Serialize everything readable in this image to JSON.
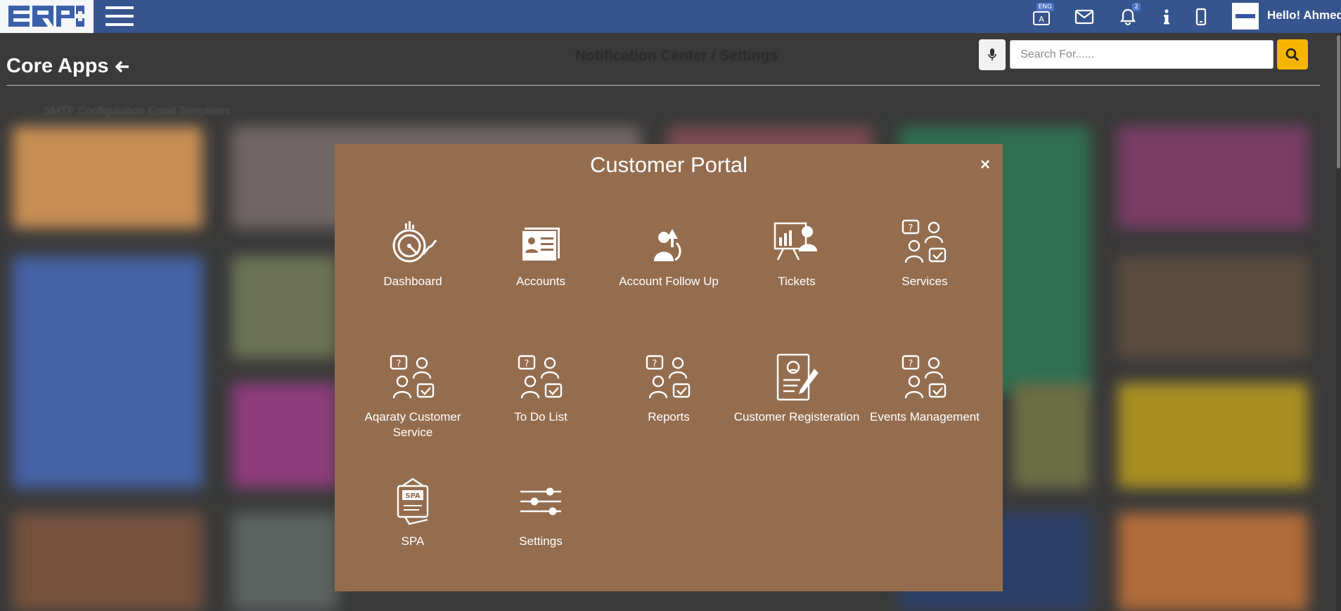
{
  "brand": {
    "logo_text": "ERP"
  },
  "topbar": {
    "lang_badge": "ENG",
    "notif_count": "2",
    "greeting": "Hello! Ahmed"
  },
  "page": {
    "title": "Core Apps",
    "heading": "Notification Center / Settings",
    "bg_text": "SMTP Configuration    Email Templates"
  },
  "search": {
    "placeholder": "Search For......"
  },
  "modal": {
    "title": "Customer Portal",
    "close": "×",
    "apps": [
      {
        "label": "Dashboard",
        "icon": "dashboard-icon"
      },
      {
        "label": "Accounts",
        "icon": "accounts-icon"
      },
      {
        "label": "Account Follow Up",
        "icon": "follow-up-icon"
      },
      {
        "label": "Tickets",
        "icon": "tickets-icon"
      },
      {
        "label": "Services",
        "icon": "services-icon"
      },
      {
        "label": "Aqaraty Customer Service",
        "icon": "customer-service-icon"
      },
      {
        "label": "To Do List",
        "icon": "todo-icon"
      },
      {
        "label": "Reports",
        "icon": "reports-icon"
      },
      {
        "label": "Customer Registeration",
        "icon": "registration-icon"
      },
      {
        "label": "Events Management",
        "icon": "events-icon"
      },
      {
        "label": "SPA",
        "icon": "spa-icon",
        "badge_text": "SPA"
      },
      {
        "label": "Settings",
        "icon": "settings-icon"
      }
    ]
  },
  "colors": {
    "topbar": "#36558e",
    "modal": "#946d4f",
    "search_button": "#f4b400",
    "overlay": "#3a3a3a"
  }
}
